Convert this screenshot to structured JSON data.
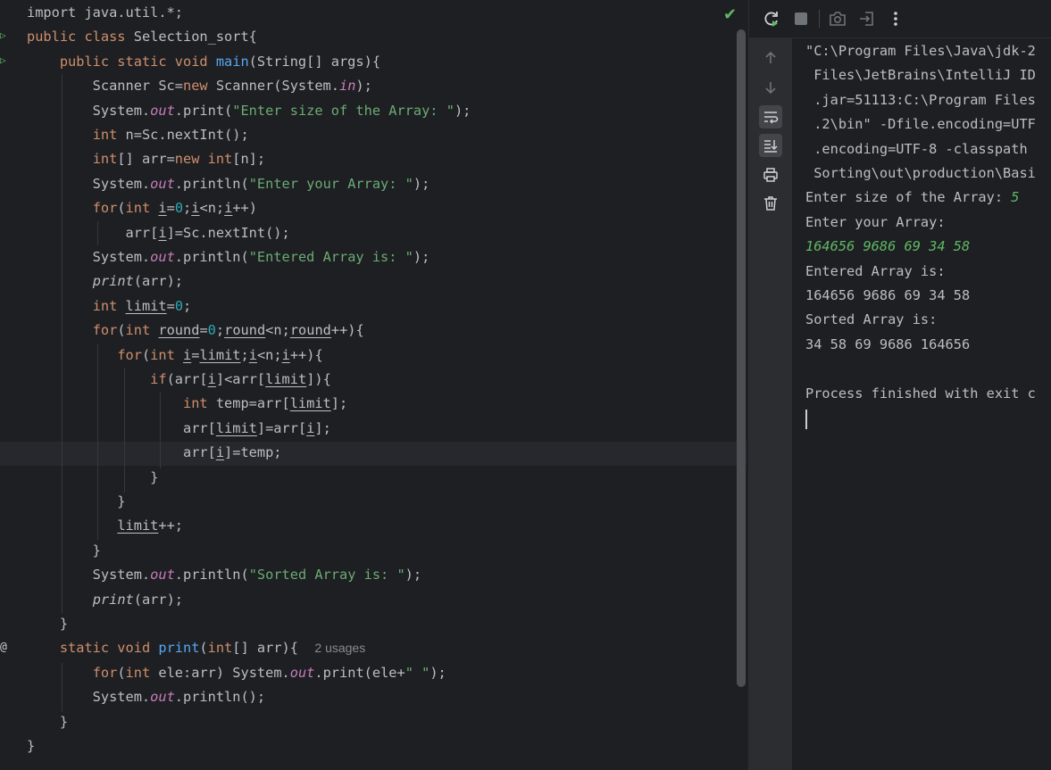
{
  "editor": {
    "lines": [
      {
        "tokens": [
          {
            "t": "import java.util.*;"
          }
        ]
      },
      {
        "tokens": [
          {
            "t": "public class ",
            "c": "kw"
          },
          {
            "t": "Selection_sort{"
          }
        ]
      },
      {
        "tokens": [
          {
            "t": "    public static void ",
            "c": "kw"
          },
          {
            "t": "main",
            "c": "fn"
          },
          {
            "t": "(String[] args){"
          }
        ]
      },
      {
        "tokens": [
          {
            "t": "        Scanner Sc="
          },
          {
            "t": "new ",
            "c": "kw"
          },
          {
            "t": "Scanner(System."
          },
          {
            "t": "in",
            "c": "fld"
          },
          {
            "t": ");"
          }
        ]
      },
      {
        "tokens": [
          {
            "t": "        System."
          },
          {
            "t": "out",
            "c": "fld"
          },
          {
            "t": ".print("
          },
          {
            "t": "\"Enter size of the Array: \"",
            "c": "str"
          },
          {
            "t": ");"
          }
        ]
      },
      {
        "tokens": [
          {
            "t": "        "
          },
          {
            "t": "int ",
            "c": "kw"
          },
          {
            "t": "n=Sc.nextInt();"
          }
        ]
      },
      {
        "tokens": [
          {
            "t": "        "
          },
          {
            "t": "int",
            "c": "kw"
          },
          {
            "t": "[] arr="
          },
          {
            "t": "new int",
            "c": "kw"
          },
          {
            "t": "[n];"
          }
        ]
      },
      {
        "tokens": [
          {
            "t": "        System."
          },
          {
            "t": "out",
            "c": "fld"
          },
          {
            "t": ".println("
          },
          {
            "t": "\"Enter your Array: \"",
            "c": "str"
          },
          {
            "t": ");"
          }
        ]
      },
      {
        "tokens": [
          {
            "t": "        "
          },
          {
            "t": "for",
            "c": "kw"
          },
          {
            "t": "("
          },
          {
            "t": "int ",
            "c": "kw"
          },
          {
            "t": "i",
            "c": "ul"
          },
          {
            "t": "="
          },
          {
            "t": "0",
            "c": "num"
          },
          {
            "t": ";"
          },
          {
            "t": "i",
            "c": "ul"
          },
          {
            "t": "<n;"
          },
          {
            "t": "i",
            "c": "ul"
          },
          {
            "t": "++)"
          }
        ]
      },
      {
        "tokens": [
          {
            "t": "            arr["
          },
          {
            "t": "i",
            "c": "ul"
          },
          {
            "t": "]=Sc.nextInt();"
          }
        ]
      },
      {
        "tokens": [
          {
            "t": "        System."
          },
          {
            "t": "out",
            "c": "fld"
          },
          {
            "t": ".println("
          },
          {
            "t": "\"Entered Array is: \"",
            "c": "str"
          },
          {
            "t": ");"
          }
        ]
      },
      {
        "tokens": [
          {
            "t": "        "
          },
          {
            "t": "print",
            "c": "it"
          },
          {
            "t": "(arr);"
          }
        ]
      },
      {
        "tokens": [
          {
            "t": "        "
          },
          {
            "t": "int ",
            "c": "kw"
          },
          {
            "t": "limit",
            "c": "ul"
          },
          {
            "t": "="
          },
          {
            "t": "0",
            "c": "num"
          },
          {
            "t": ";"
          }
        ]
      },
      {
        "tokens": [
          {
            "t": "        "
          },
          {
            "t": "for",
            "c": "kw"
          },
          {
            "t": "("
          },
          {
            "t": "int ",
            "c": "kw"
          },
          {
            "t": "round",
            "c": "ul"
          },
          {
            "t": "="
          },
          {
            "t": "0",
            "c": "num"
          },
          {
            "t": ";"
          },
          {
            "t": "round",
            "c": "ul"
          },
          {
            "t": "<n;"
          },
          {
            "t": "round",
            "c": "ul"
          },
          {
            "t": "++){"
          }
        ]
      },
      {
        "tokens": [
          {
            "t": "           "
          },
          {
            "t": "for",
            "c": "kw"
          },
          {
            "t": "("
          },
          {
            "t": "int ",
            "c": "kw"
          },
          {
            "t": "i",
            "c": "ul"
          },
          {
            "t": "="
          },
          {
            "t": "limit",
            "c": "ul"
          },
          {
            "t": ";"
          },
          {
            "t": "i",
            "c": "ul"
          },
          {
            "t": "<n;"
          },
          {
            "t": "i",
            "c": "ul"
          },
          {
            "t": "++){"
          }
        ]
      },
      {
        "tokens": [
          {
            "t": "               "
          },
          {
            "t": "if",
            "c": "kw"
          },
          {
            "t": "(arr["
          },
          {
            "t": "i",
            "c": "ul"
          },
          {
            "t": "]<arr["
          },
          {
            "t": "limit",
            "c": "ul"
          },
          {
            "t": "]){"
          }
        ]
      },
      {
        "tokens": [
          {
            "t": "                   "
          },
          {
            "t": "int ",
            "c": "kw"
          },
          {
            "t": "temp=arr["
          },
          {
            "t": "limit",
            "c": "ul"
          },
          {
            "t": "];"
          }
        ]
      },
      {
        "tokens": [
          {
            "t": "                   arr["
          },
          {
            "t": "limit",
            "c": "ul"
          },
          {
            "t": "]=arr["
          },
          {
            "t": "i",
            "c": "ul"
          },
          {
            "t": "];"
          }
        ]
      },
      {
        "tokens": [
          {
            "t": "                   arr["
          },
          {
            "t": "i",
            "c": "ul"
          },
          {
            "t": "]=temp;"
          }
        ]
      },
      {
        "tokens": [
          {
            "t": "               }"
          }
        ]
      },
      {
        "tokens": [
          {
            "t": "           }"
          }
        ]
      },
      {
        "tokens": [
          {
            "t": "           "
          },
          {
            "t": "limit",
            "c": "ul"
          },
          {
            "t": "++;"
          }
        ]
      },
      {
        "tokens": [
          {
            "t": "        }"
          }
        ]
      },
      {
        "tokens": [
          {
            "t": "        System."
          },
          {
            "t": "out",
            "c": "fld"
          },
          {
            "t": ".println("
          },
          {
            "t": "\"Sorted Array is: \"",
            "c": "str"
          },
          {
            "t": ");"
          }
        ]
      },
      {
        "tokens": [
          {
            "t": "        "
          },
          {
            "t": "print",
            "c": "it"
          },
          {
            "t": "(arr);"
          }
        ]
      },
      {
        "tokens": [
          {
            "t": "    }"
          }
        ]
      },
      {
        "tokens": [
          {
            "t": "    "
          },
          {
            "t": "static void ",
            "c": "kw"
          },
          {
            "t": "print",
            "c": "fn"
          },
          {
            "t": "("
          },
          {
            "t": "int",
            "c": "kw"
          },
          {
            "t": "[] arr){  "
          },
          {
            "t": "2 usages",
            "c": "hint"
          }
        ]
      },
      {
        "tokens": [
          {
            "t": "        "
          },
          {
            "t": "for",
            "c": "kw"
          },
          {
            "t": "("
          },
          {
            "t": "int ",
            "c": "kw"
          },
          {
            "t": "ele:arr) System."
          },
          {
            "t": "out",
            "c": "fld"
          },
          {
            "t": ".print(ele+"
          },
          {
            "t": "\" \"",
            "c": "str"
          },
          {
            "t": ");"
          }
        ]
      },
      {
        "tokens": [
          {
            "t": "        System."
          },
          {
            "t": "out",
            "c": "fld"
          },
          {
            "t": ".println();"
          }
        ]
      },
      {
        "tokens": [
          {
            "t": "    }"
          }
        ]
      },
      {
        "tokens": [
          {
            "t": "}"
          }
        ]
      }
    ]
  },
  "console": {
    "lines": [
      {
        "segs": [
          {
            "t": "\"C:\\Program Files\\Java\\jdk-2"
          }
        ]
      },
      {
        "segs": [
          {
            "t": " Files\\JetBrains\\IntelliJ ID"
          }
        ]
      },
      {
        "segs": [
          {
            "t": " .jar=51113:C:\\Program Files"
          }
        ]
      },
      {
        "segs": [
          {
            "t": " .2\\bin\" -Dfile.encoding=UTF"
          }
        ]
      },
      {
        "segs": [
          {
            "t": " .encoding=UTF-8 -classpath "
          }
        ]
      },
      {
        "segs": [
          {
            "t": " Sorting\\out\\production\\Basi"
          }
        ]
      },
      {
        "segs": [
          {
            "t": "Enter size of the Array: "
          },
          {
            "t": "5",
            "c": "inp"
          }
        ]
      },
      {
        "segs": [
          {
            "t": "Enter your Array:"
          }
        ]
      },
      {
        "segs": [
          {
            "t": "164656 9686 69 34 58",
            "c": "inp"
          }
        ]
      },
      {
        "segs": [
          {
            "t": "Entered Array is:"
          }
        ]
      },
      {
        "segs": [
          {
            "t": "164656 9686 69 34 58"
          }
        ]
      },
      {
        "segs": [
          {
            "t": "Sorted Array is:"
          }
        ]
      },
      {
        "segs": [
          {
            "t": "34 58 69 9686 164656"
          }
        ]
      },
      {
        "segs": [
          {
            "t": ""
          }
        ]
      },
      {
        "segs": [
          {
            "t": "Process finished with exit c"
          }
        ]
      }
    ]
  },
  "toolbar": {
    "buttons": [
      "rerun-icon",
      "stop-icon",
      "camera-icon",
      "exit-icon",
      "more-icon"
    ]
  },
  "sidebar": {
    "buttons": [
      "arrow-up-icon",
      "arrow-down-icon",
      "soft-wrap-icon",
      "scroll-to-end-icon",
      "print-icon",
      "trash-icon"
    ]
  }
}
